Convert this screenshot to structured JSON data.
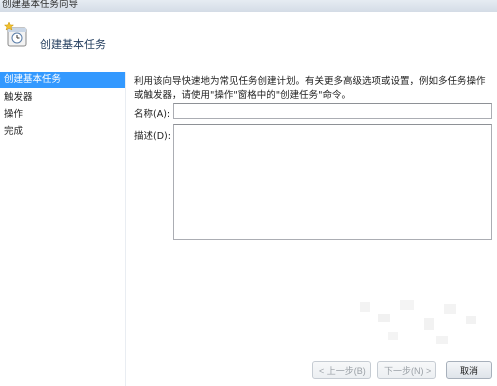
{
  "window": {
    "title": "创建基本任务向导"
  },
  "header": {
    "title": "创建基本任务",
    "icon": "task-wizard-icon"
  },
  "sidebar": {
    "steps": [
      {
        "label": "创建基本任务",
        "active": true
      },
      {
        "label": "触发器",
        "active": false
      },
      {
        "label": "操作",
        "active": false
      },
      {
        "label": "完成",
        "active": false
      }
    ]
  },
  "main": {
    "description": "利用该向导快速地为常见任务创建计划。有关更多高级选项或设置，例如多任务操作或触发器，请使用\"操作\"窗格中的\"创建任务\"命令。",
    "name_label": "名称(A):",
    "name_value": "",
    "desc_label": "描述(D):",
    "desc_value": ""
  },
  "buttons": {
    "back": "< 上一步(B)",
    "next": "下一步(N) >",
    "cancel": "取消"
  },
  "colors": {
    "selection": "#3399ff",
    "header_text": "#1e395b"
  }
}
